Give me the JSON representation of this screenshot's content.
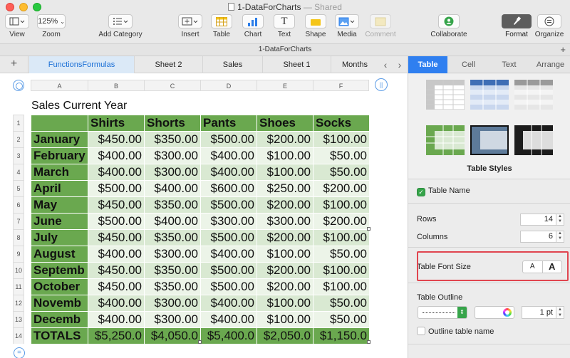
{
  "window": {
    "title": "1-DataForCharts",
    "subtitle": "— Shared"
  },
  "toolbar": {
    "view": "View",
    "zoom": "Zoom",
    "zoom_value": "125%",
    "add_category": "Add Category",
    "insert": "Insert",
    "table": "Table",
    "chart": "Chart",
    "text": "Text",
    "shape": "Shape",
    "media": "Media",
    "comment": "Comment",
    "collaborate": "Collaborate",
    "format": "Format",
    "organize": "Organize"
  },
  "doc_bar": {
    "title": "1-DataForCharts",
    "add": "+"
  },
  "sheet_tabs": {
    "add": "+",
    "tabs": [
      "FunctionsFormulas",
      "Sheet 2",
      "Sales",
      "Sheet 1",
      "Months"
    ],
    "prev": "‹",
    "next": "›"
  },
  "columns": [
    "A",
    "B",
    "C",
    "D",
    "E",
    "F"
  ],
  "rows": [
    "1",
    "2",
    "3",
    "4",
    "5",
    "6",
    "7",
    "8",
    "9",
    "10",
    "11",
    "12",
    "13",
    "14"
  ],
  "table": {
    "title": "Sales Current Year",
    "headers": [
      "",
      "Shirts",
      "Shorts",
      "Pants",
      "Shoes",
      "Socks"
    ],
    "body": [
      [
        "January",
        "$450.00",
        "$350.00",
        "$500.00",
        "$200.00",
        "$100.00"
      ],
      [
        "February",
        "$400.00",
        "$300.00",
        "$400.00",
        "$100.00",
        "$50.00"
      ],
      [
        "March",
        "$400.00",
        "$300.00",
        "$400.00",
        "$100.00",
        "$50.00"
      ],
      [
        "April",
        "$500.00",
        "$400.00",
        "$600.00",
        "$250.00",
        "$200.00"
      ],
      [
        "May",
        "$450.00",
        "$350.00",
        "$500.00",
        "$200.00",
        "$100.00"
      ],
      [
        "June",
        "$500.00",
        "$400.00",
        "$300.00",
        "$300.00",
        "$200.00"
      ],
      [
        "July",
        "$450.00",
        "$350.00",
        "$500.00",
        "$200.00",
        "$100.00"
      ],
      [
        "August",
        "$400.00",
        "$300.00",
        "$400.00",
        "$100.00",
        "$50.00"
      ],
      [
        "Septemb",
        "$450.00",
        "$350.00",
        "$500.00",
        "$200.00",
        "$100.00"
      ],
      [
        "October",
        "$450.00",
        "$350.00",
        "$500.00",
        "$200.00",
        "$100.00"
      ],
      [
        "Novemb",
        "$400.00",
        "$300.00",
        "$400.00",
        "$100.00",
        "$50.00"
      ],
      [
        "Decemb",
        "$400.00",
        "$300.00",
        "$400.00",
        "$100.00",
        "$50.00"
      ]
    ],
    "total": [
      "TOTALS",
      "$5,250.0",
      "$4,050.0",
      "$5,400.0",
      "$2,050.0",
      "$1,150.0"
    ]
  },
  "inspector": {
    "tabs": [
      "Table",
      "Cell",
      "Text",
      "Arrange"
    ],
    "styles_label": "Table Styles",
    "table_name_label": "Table Name",
    "table_name_checked": true,
    "rows_label": "Rows",
    "rows_value": "14",
    "columns_label": "Columns",
    "columns_value": "6",
    "font_size_label": "Table Font Size",
    "font_small": "A",
    "font_large": "A",
    "outline_label": "Table Outline",
    "outline_width": "1 pt",
    "outline_name_label": "Outline table name",
    "outline_name_checked": false
  },
  "colors": {
    "accent": "#2f7ff0",
    "header_green": "#6aa84f",
    "band_dark": "#d9e9d2",
    "band_light": "#ecf4e8",
    "highlight_red": "#e0454f"
  }
}
